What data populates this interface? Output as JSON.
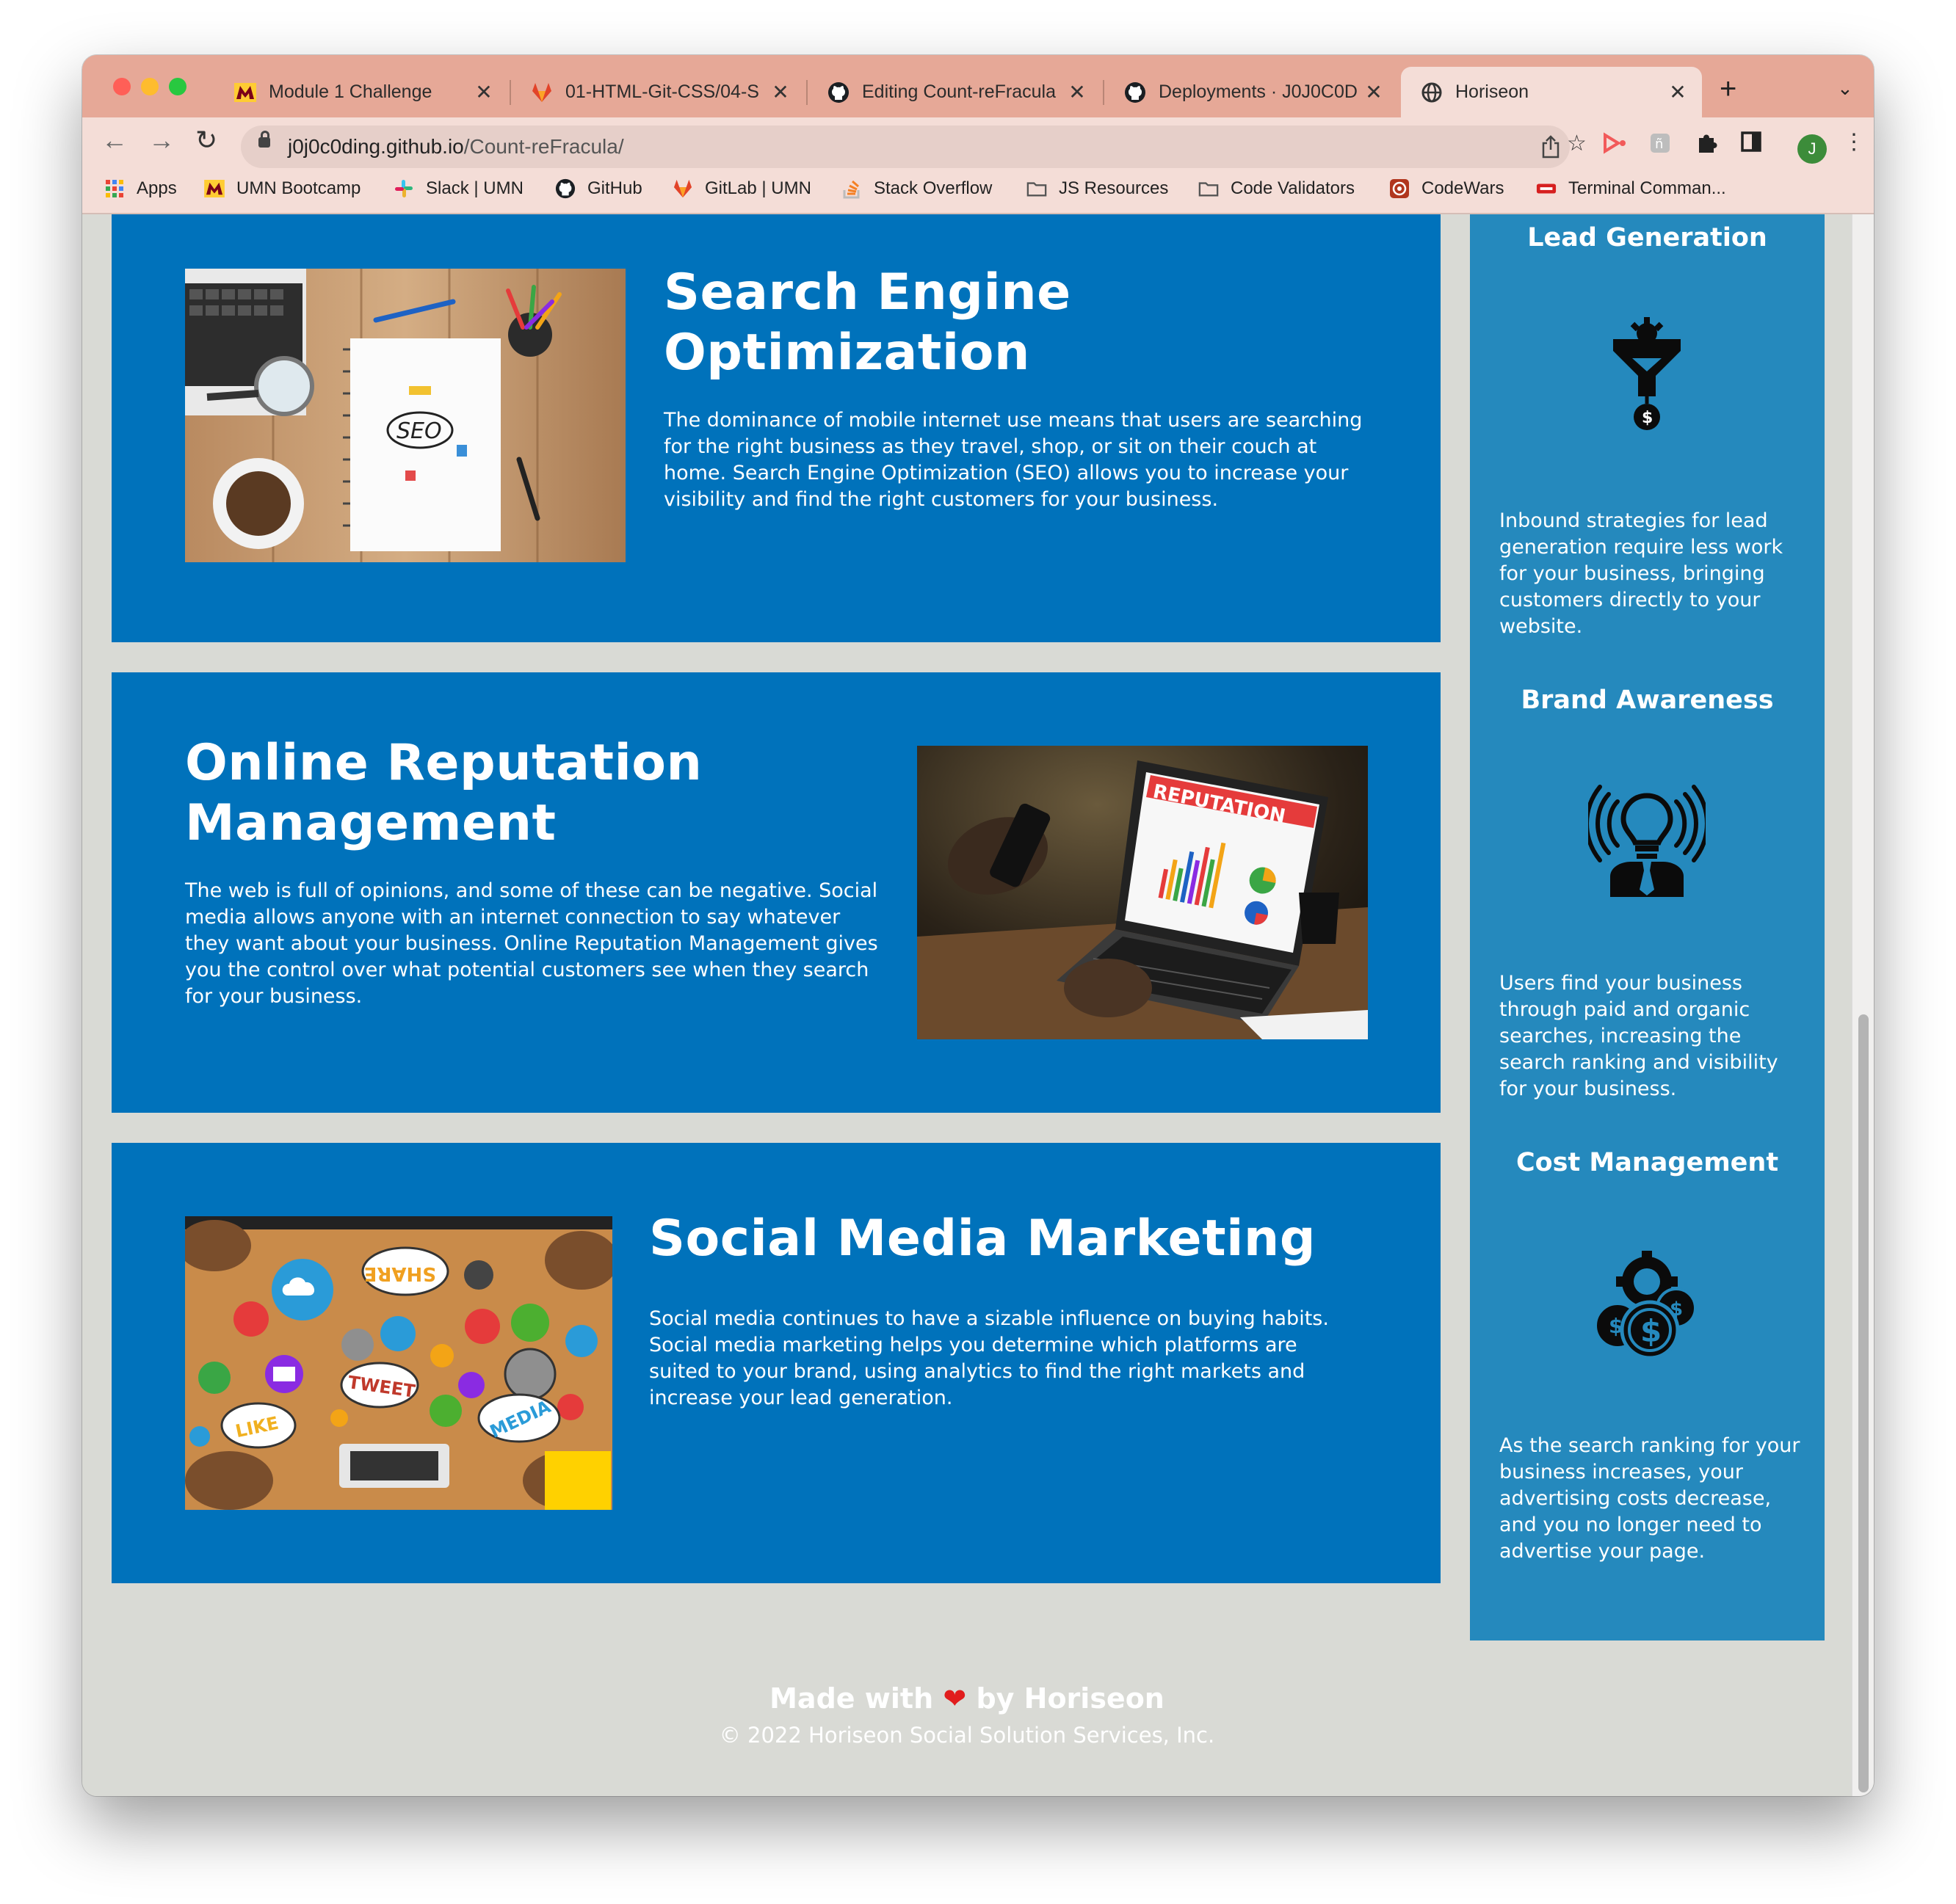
{
  "browser": {
    "tabs": [
      {
        "title": "Module 1 Challenge",
        "icon": "umn-icon"
      },
      {
        "title": "01-HTML-Git-CSS/04-S",
        "icon": "gitlab-icon"
      },
      {
        "title": "Editing Count-reFracula",
        "icon": "github-icon"
      },
      {
        "title": "Deployments · J0J0C0D",
        "icon": "github-icon"
      },
      {
        "title": "Horiseon",
        "icon": "globe-icon",
        "active": true
      }
    ],
    "url_host": "j0j0c0ding.github.io",
    "url_path": "/Count-reFracula/",
    "avatar_initial": "J",
    "bookmarks": [
      {
        "label": "Apps",
        "icon": "apps-grid-icon"
      },
      {
        "label": "UMN Bootcamp",
        "icon": "umn-icon"
      },
      {
        "label": "Slack | UMN",
        "icon": "slack-icon"
      },
      {
        "label": "GitHub",
        "icon": "github-icon"
      },
      {
        "label": "GitLab | UMN",
        "icon": "gitlab-icon"
      },
      {
        "label": "Stack Overflow",
        "icon": "stackoverflow-icon"
      },
      {
        "label": "JS Resources",
        "icon": "folder-icon"
      },
      {
        "label": "Code Validators",
        "icon": "folder-icon"
      },
      {
        "label": "CodeWars",
        "icon": "codewars-icon"
      },
      {
        "label": "Terminal Comman...",
        "icon": "terminal-icon"
      }
    ]
  },
  "sections": [
    {
      "title": "Search Engine Optimization",
      "title_line1": "Search Engine",
      "title_line2": "Optimization",
      "body": "The dominance of mobile internet use means that users are searching for the right business as they travel, shop, or sit on their couch at home. Search Engine Optimization (SEO) allows you to increase your visibility and find the right customers for your business.",
      "image_text": "SEO"
    },
    {
      "title": "Online Reputation Management",
      "title_line1": "Online Reputation",
      "title_line2": "Management",
      "body": "The web is full of opinions, and some of these can be negative. Social media allows anyone with an internet connection to say whatever they want about your business. Online Reputation Management gives you the control over what potential customers see when they search for your business.",
      "image_text": "REPUTATION"
    },
    {
      "title": "Social Media Marketing",
      "body": "Social media continues to have a sizable influence on buying habits. Social media marketing helps you determine which platforms are suited to your brand, using analytics to find the right markets and increase your lead generation.",
      "image_words": [
        "SHARE",
        "TWEET",
        "LIKE",
        "MEDIA"
      ]
    }
  ],
  "benefits": [
    {
      "title": "Lead Generation",
      "icon": "lead-funnel-icon",
      "body": "Inbound strategies for lead generation require less work for your business, bringing customers directly to your website."
    },
    {
      "title": "Brand Awareness",
      "icon": "brand-bulb-icon",
      "body": "Users find your business through paid and organic searches, increasing the search ranking and visibility for your business."
    },
    {
      "title": "Cost Management",
      "icon": "cost-coins-icon",
      "body": "As the search ranking for your business increases, your advertising costs decrease, and you no longer need to advertise your page."
    }
  ],
  "footer": {
    "made_prefix": "Made with",
    "heart": "❤",
    "made_suffix": "by Horiseon",
    "copyright": "© 2022 Horiseon Social Solution Services, Inc."
  }
}
